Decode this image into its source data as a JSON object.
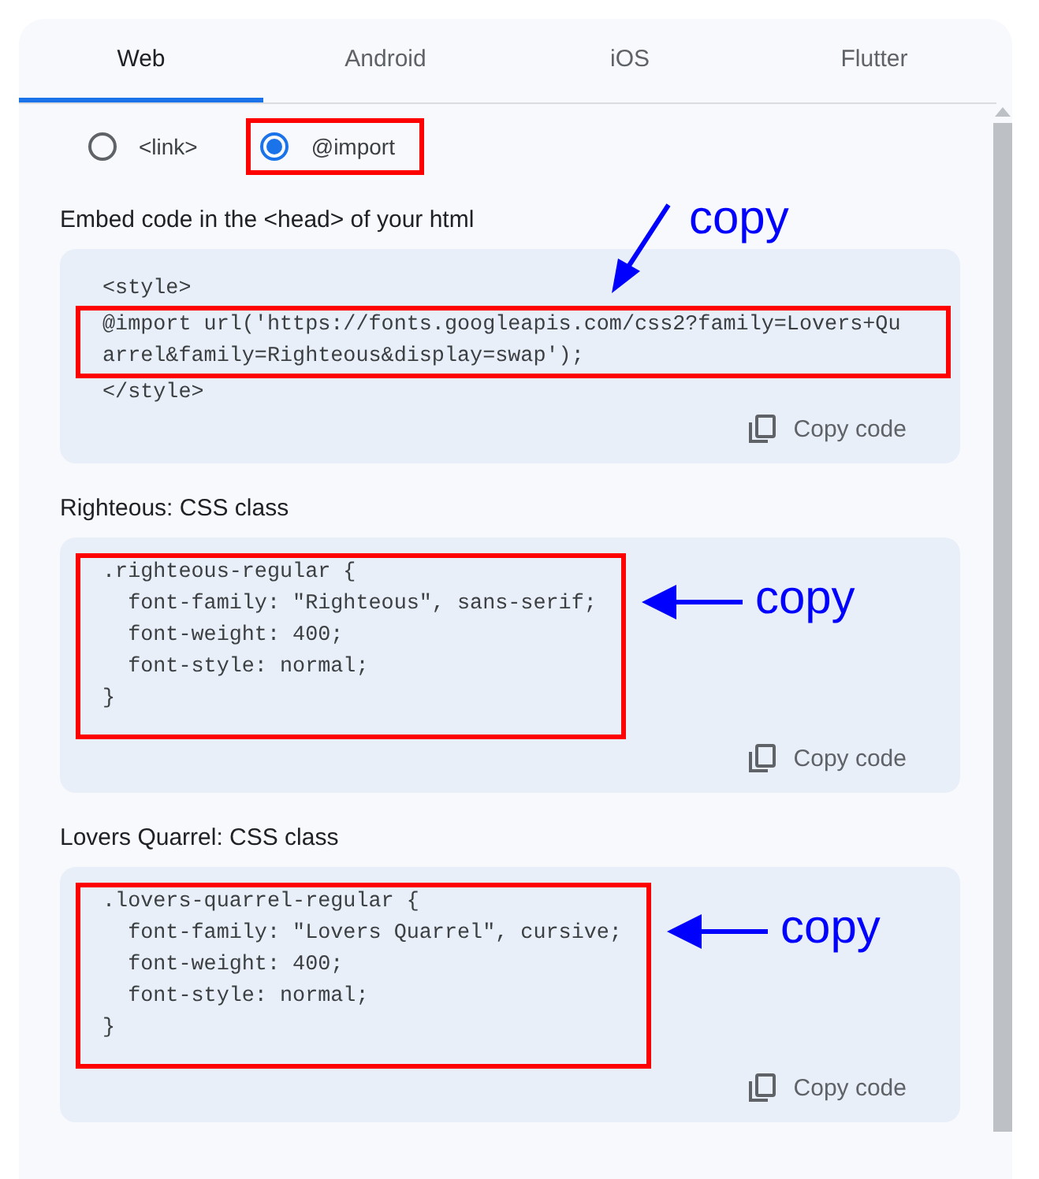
{
  "tabs": [
    {
      "label": "Web",
      "selected": true
    },
    {
      "label": "Android",
      "selected": false
    },
    {
      "label": "iOS",
      "selected": false
    },
    {
      "label": "Flutter",
      "selected": false
    }
  ],
  "embed_options": [
    {
      "label": "<link>",
      "selected": false,
      "annotated": false
    },
    {
      "label": "@import",
      "selected": true,
      "annotated": true
    }
  ],
  "code_blocks": [
    {
      "label": "Embed code in the <head> of your html",
      "lines": [
        {
          "text": "<style>",
          "highlighted": false
        },
        {
          "text": "@import url('https://fonts.googleapis.com/css2?family=Lovers+Qu",
          "highlighted": true
        },
        {
          "text": "arrel&family=Righteous&display=swap');",
          "highlighted": true
        },
        {
          "text": "</style>",
          "highlighted": false
        }
      ],
      "button": "Copy code",
      "annotation": {
        "label": "copy",
        "kind": "diagonal"
      }
    },
    {
      "label": "Righteous: CSS class",
      "lines": [
        {
          "text": ".righteous-regular {",
          "highlighted": true
        },
        {
          "text": "  font-family: \"Righteous\", sans-serif;",
          "highlighted": true
        },
        {
          "text": "  font-weight: 400;",
          "highlighted": true
        },
        {
          "text": "  font-style: normal;",
          "highlighted": true
        },
        {
          "text": "}",
          "highlighted": true
        }
      ],
      "button": "Copy code",
      "annotation": {
        "label": "copy",
        "kind": "left"
      }
    },
    {
      "label": "Lovers Quarrel: CSS class",
      "lines": [
        {
          "text": ".lovers-quarrel-regular {",
          "highlighted": true
        },
        {
          "text": "  font-family: \"Lovers Quarrel\", cursive;",
          "highlighted": true
        },
        {
          "text": "  font-weight: 400;",
          "highlighted": true
        },
        {
          "text": "  font-style: normal;",
          "highlighted": true
        },
        {
          "text": "}",
          "highlighted": true
        }
      ],
      "button": "Copy code",
      "annotation": {
        "label": "copy",
        "kind": "left"
      }
    }
  ]
}
